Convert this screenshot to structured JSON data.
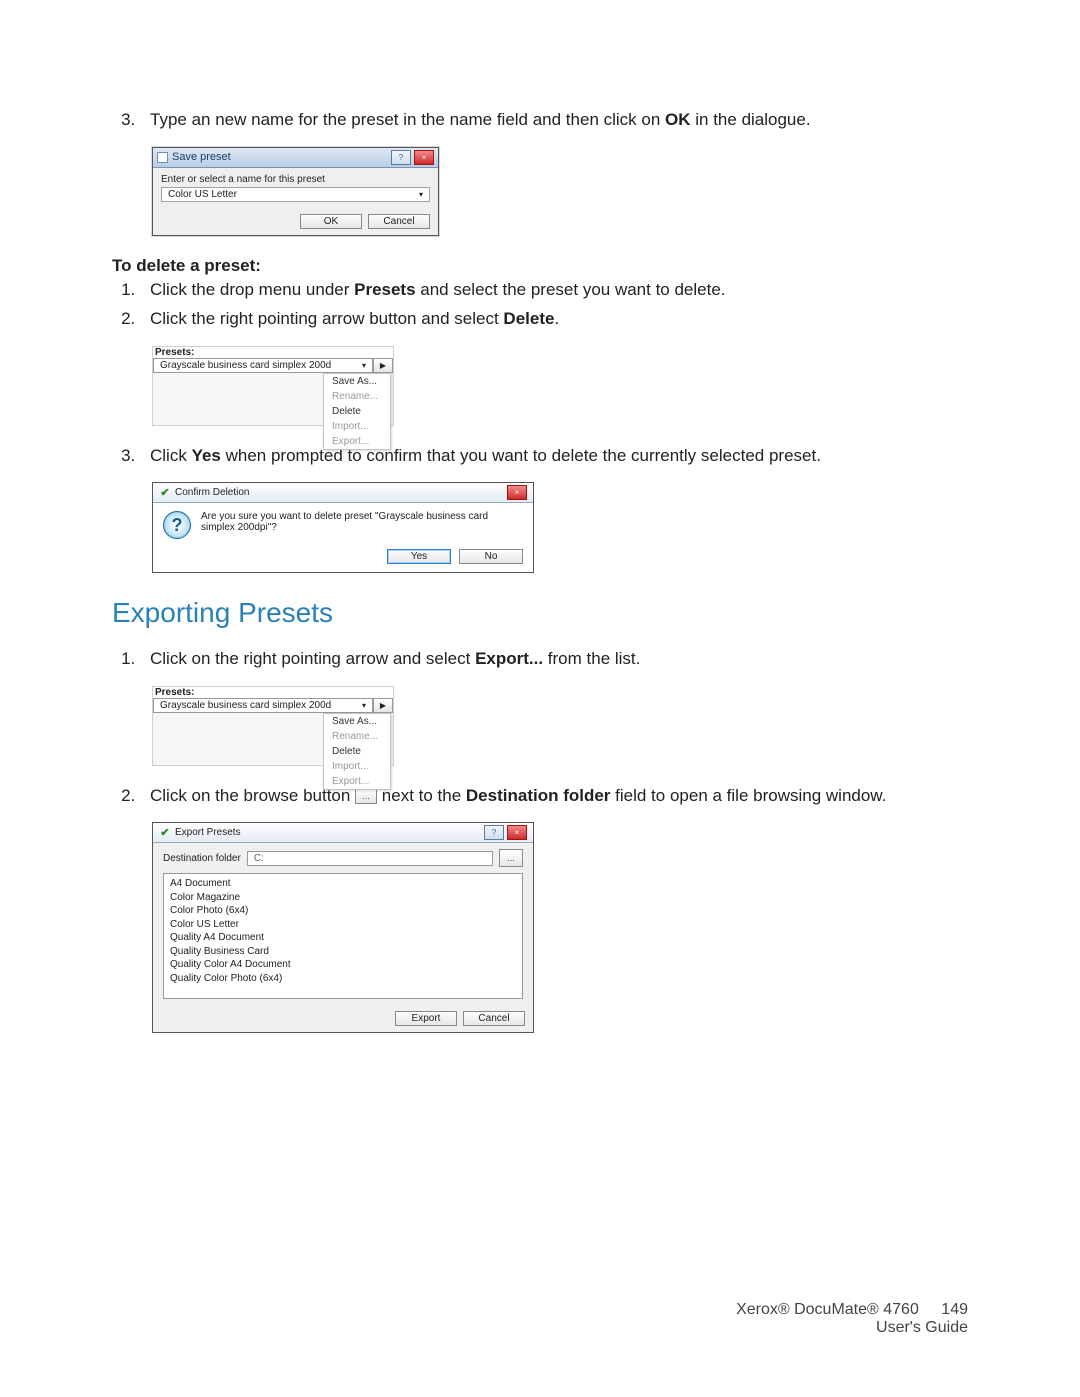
{
  "step3_intro": {
    "num": "3.",
    "pre": "Type an new name for the preset in the name field and then click on ",
    "ok": "OK",
    "post": " in the dialogue."
  },
  "save_preset_dlg": {
    "title": "Save preset",
    "help_btn": "?",
    "close_btn": "×",
    "instruction": "Enter or select a name for this preset",
    "value": "Color US Letter",
    "ok": "OK",
    "cancel": "Cancel"
  },
  "delete_heading": "To delete a preset:",
  "delete_steps": {
    "s1": {
      "pre": "Click the drop menu under ",
      "bold": "Presets",
      "post": " and select the preset you want to delete."
    },
    "s2": {
      "pre": "Click the right pointing arrow button and select ",
      "bold": "Delete",
      "post": "."
    },
    "s3": {
      "pre": "Click ",
      "bold": "Yes",
      "post": " when prompted to confirm that you want to delete the currently selected preset."
    }
  },
  "preset_panel": {
    "label": "Presets:",
    "selected": "Grayscale business card simplex 200d",
    "menu": {
      "save_as": "Save As...",
      "rename": "Rename...",
      "delete": "Delete",
      "import": "Import...",
      "export": "Export..."
    }
  },
  "confirm_dlg": {
    "title": "Confirm Deletion",
    "message": "Are you sure you want to delete preset \"Grayscale business card simplex 200dpi\"?",
    "yes": "Yes",
    "no": "No"
  },
  "exporting_heading": "Exporting Presets",
  "export_steps": {
    "s1": {
      "pre": "Click on the right pointing arrow and select ",
      "bold": "Export...",
      "post": " from the list."
    },
    "s2": {
      "pre": "Click on the browse button ",
      "mid": " next to the ",
      "bold": "Destination folder",
      "post": " field to open a file browsing window."
    }
  },
  "export_dlg": {
    "title": "Export Presets",
    "help_btn": "?",
    "close_btn": "×",
    "dest_label": "Destination folder",
    "dest_value": "C:",
    "list": [
      "A4 Document",
      "Color Magazine",
      "Color Photo (6x4)",
      "Color US Letter",
      "Quality A4 Document",
      "Quality Business Card",
      "Quality Color A4 Document",
      "Quality Color Photo (6x4)"
    ],
    "export_btn": "Export",
    "cancel_btn": "Cancel"
  },
  "footer": {
    "line1_pre": "Xerox® DocuMate® 4760",
    "page": "149",
    "line2": "User's Guide"
  }
}
